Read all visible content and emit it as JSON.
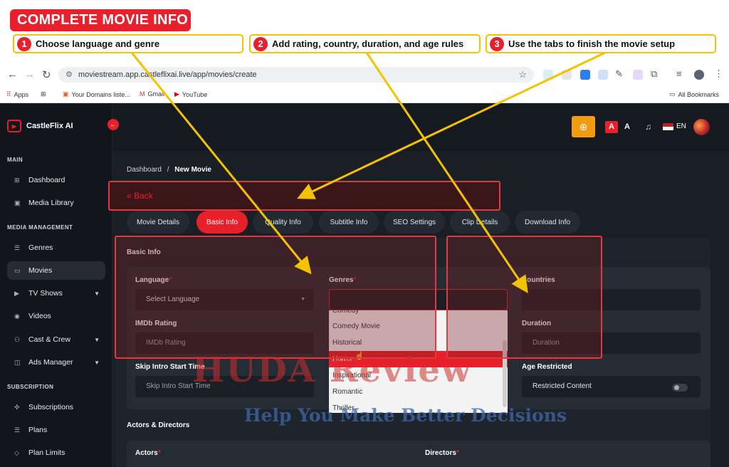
{
  "tutorial": {
    "title": "COMPLETE MOVIE INFO",
    "steps": [
      {
        "num": "1",
        "text": "Choose language and genre"
      },
      {
        "num": "2",
        "text": "Add rating, country, duration, and age rules"
      },
      {
        "num": "3",
        "text": "Use the tabs to finish the movie setup"
      }
    ]
  },
  "browser": {
    "url": "moviestream.app.castleflixai.live/app/movies/create",
    "bookmarks": [
      "Apps",
      "Your Domains liste...",
      "Gmail",
      "YouTube"
    ],
    "all_bookmarks": "All Bookmarks"
  },
  "app": {
    "logo": "CastleFlix AI",
    "lang_code": "EN",
    "font_a_active": "A",
    "font_a": "A"
  },
  "sidebar": {
    "sections": [
      "MAIN",
      "MEDIA MANAGEMENT",
      "SUBSCRIPTION"
    ],
    "items": [
      {
        "label": "Dashboard",
        "icon": "grid-icon"
      },
      {
        "label": "Media Library",
        "icon": "image-icon"
      },
      {
        "label": "Genres",
        "icon": "list-icon"
      },
      {
        "label": "Movies",
        "icon": "film-icon"
      },
      {
        "label": "TV Shows",
        "icon": "tv-icon"
      },
      {
        "label": "Videos",
        "icon": "video-icon"
      },
      {
        "label": "Cast & Crew",
        "icon": "users-icon"
      },
      {
        "label": "Ads Manager",
        "icon": "ads-icon"
      },
      {
        "label": "Subscriptions",
        "icon": "subscription-icon"
      },
      {
        "label": "Plans",
        "icon": "plans-icon"
      },
      {
        "label": "Plan Limits",
        "icon": "tag-icon"
      }
    ]
  },
  "breadcrumb": {
    "home": "Dashboard",
    "sep": "/",
    "current": "New Movie"
  },
  "back_label": "« Back",
  "tabs": [
    "Movie Details",
    "Basic Info",
    "Quality Info",
    "Subtitle Info",
    "SEO Settings",
    "Clip Details",
    "Download Info"
  ],
  "basic_info": {
    "title": "Basic Info",
    "language_label": "Language",
    "language_placeholder": "Select Language",
    "genres_label": "Genres",
    "countries_label": "Countries",
    "imdb_label": "IMDb Rating",
    "imdb_placeholder": "IMDb Rating",
    "duration_label": "Duration",
    "duration_placeholder": "Duration",
    "skip_intro_label": "Skip Intro Start Time",
    "skip_intro_placeholder": "Skip Intro Start Time",
    "age_restricted_label": "Age Restricted",
    "restricted_content": "Restricted Content",
    "genre_options": [
      "Comedy",
      "Comedy Movie",
      "Historical",
      "Horror",
      "Inspirational",
      "Romantic",
      "Thriller"
    ]
  },
  "actors_directors": {
    "title": "Actors & Directors",
    "actors_label": "Actors",
    "directors_label": "Directors"
  },
  "watermark": {
    "line1": "HUDA Review",
    "line2": "Help You Make Better Decisions"
  },
  "colors": {
    "accent": "#e8202b",
    "highlight": "#f5c200",
    "bg": "#101419"
  }
}
